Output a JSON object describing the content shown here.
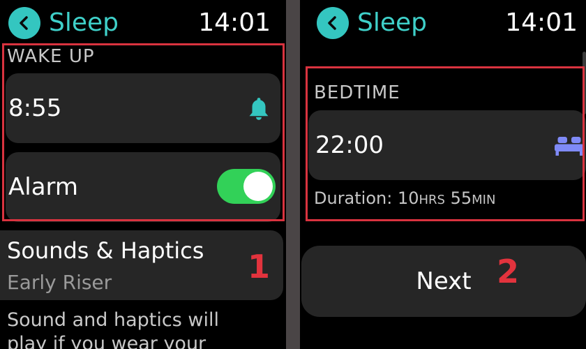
{
  "left": {
    "header": {
      "title": "Sleep",
      "time": "14:01"
    },
    "wake_up": {
      "label": "WAKE UP",
      "time": "8:55",
      "alarm_label": "Alarm",
      "alarm_on": true
    },
    "sounds": {
      "title": "Sounds & Haptics",
      "value": "Early Riser"
    },
    "description": "Sound and haptics will play if you wear your",
    "step_number": "1"
  },
  "right": {
    "header": {
      "title": "Sleep",
      "time": "14:01"
    },
    "bedtime": {
      "label": "BEDTIME",
      "time": "22:00",
      "duration_prefix": "Duration: 10",
      "duration_hrs_unit": "HRS",
      "duration_min_value": " 55",
      "duration_min_unit": "MIN"
    },
    "next_label": "Next",
    "step_number": "2"
  },
  "colors": {
    "accent_teal": "#3fd0c9",
    "toggle_green": "#32d158",
    "highlight_red": "#d9333f",
    "bed_icon_blue": "#7f8af7",
    "card_bg": "#262626"
  },
  "icons": [
    "back-chevron-icon",
    "bell-icon",
    "bed-icon"
  ]
}
